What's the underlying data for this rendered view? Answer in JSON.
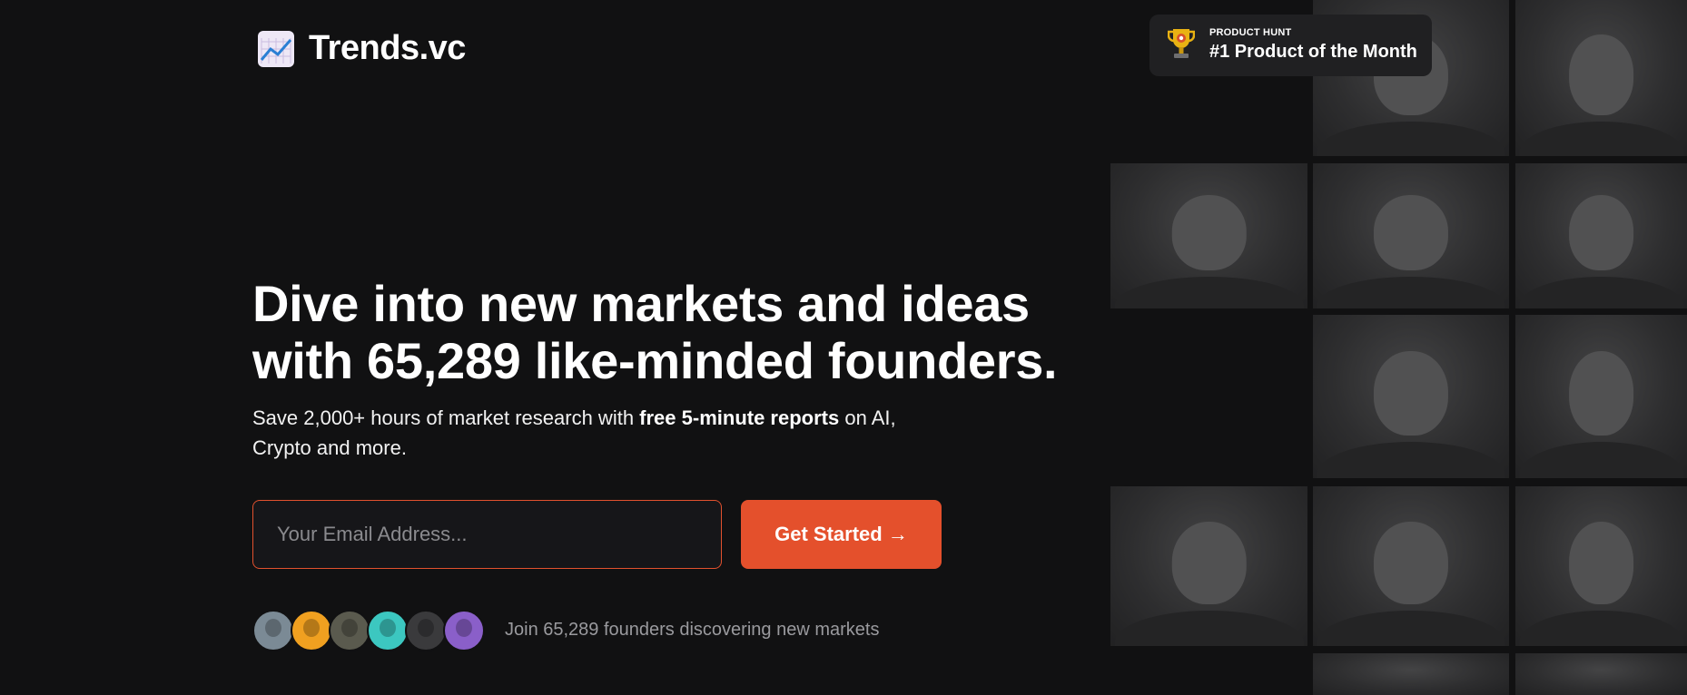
{
  "brand": {
    "name": "Trends.vc",
    "logo_icon": "chart-increasing-icon"
  },
  "badge": {
    "label": "PRODUCT HUNT",
    "title": "#1 Product of the Month",
    "icon": "trophy-icon"
  },
  "hero": {
    "headline_line1": "Dive into new markets and ideas",
    "headline_line2": "with 65,289 like-minded founders.",
    "sub_before": "Save 2,000+ hours of market research with ",
    "sub_bold": "free 5-minute reports",
    "sub_after": " on AI, Crypto and more."
  },
  "signup": {
    "email_placeholder": "Your Email Address...",
    "email_value": "",
    "cta_label": "Get Started →"
  },
  "social_proof": {
    "text": "Join 65,289 founders discovering new markets",
    "avatar_colors": [
      "#7b8a95",
      "#f0a020",
      "#5a5a4e",
      "#3cc7c0",
      "#3a3a3c",
      "#8a5fc9"
    ]
  },
  "colors": {
    "background": "#111112",
    "accent": "#e4502c",
    "input_border": "#e2512e",
    "muted_text": "#9a9a9e"
  }
}
